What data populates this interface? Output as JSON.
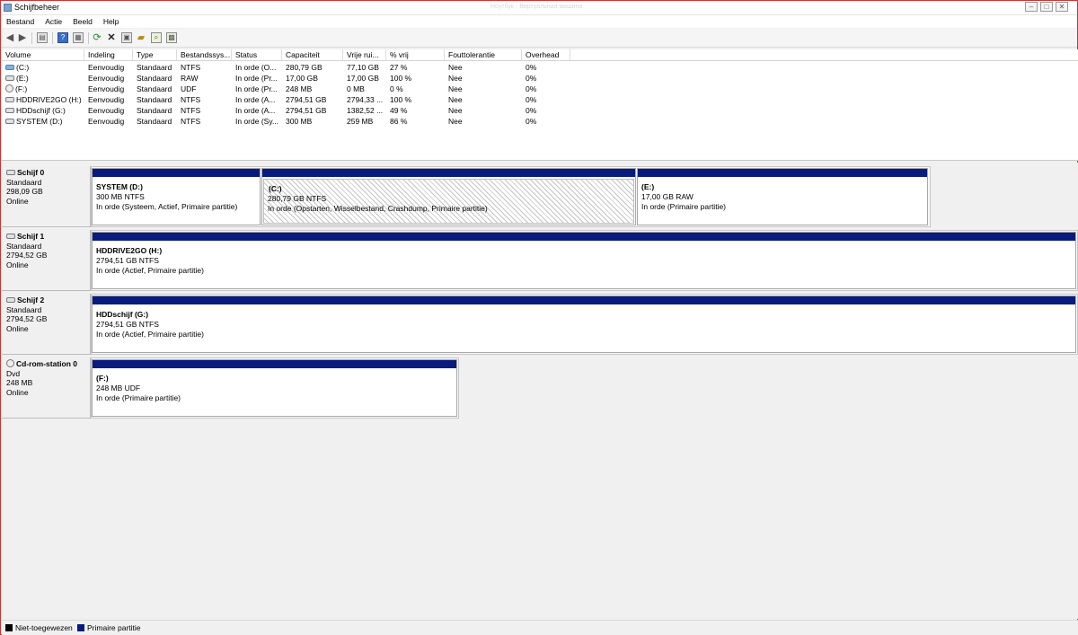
{
  "window": {
    "title": "Schijfbeheer",
    "faint_title": "Ноутбук - Виртуальная машина",
    "controls": {
      "minimize": "–",
      "maximize": "□",
      "close": "✕"
    }
  },
  "menu": [
    "Bestand",
    "Actie",
    "Beeld",
    "Help"
  ],
  "toolbar": [
    "back-icon",
    "forward-icon",
    "console-tree-icon",
    "help-icon",
    "properties-icon",
    "refresh-icon",
    "delete-icon",
    "new-volume-icon",
    "open-icon",
    "search-icon",
    "help-topics-icon"
  ],
  "volume_table": {
    "columns": [
      "Volume",
      "Indeling",
      "Type",
      "Bestandssys...",
      "Status",
      "Capaciteit",
      "Vrije rui...",
      "% vrij",
      "Fouttolerantie",
      "Overhead"
    ],
    "rows": [
      {
        "name": "(C:)",
        "icon": "system-disk-icon",
        "layout": "Eenvoudig",
        "type": "Standaard",
        "fs": "NTFS",
        "status": "In orde (O...",
        "capacity": "280,79 GB",
        "free": "77,10 GB",
        "pct_free": "27 %",
        "fault": "Nee",
        "overhead": "0%"
      },
      {
        "name": "(E:)",
        "icon": "disk-icon",
        "layout": "Eenvoudig",
        "type": "Standaard",
        "fs": "RAW",
        "status": "In orde (Pr...",
        "capacity": "17,00 GB",
        "free": "17,00 GB",
        "pct_free": "100 %",
        "fault": "Nee",
        "overhead": "0%"
      },
      {
        "name": "(F:)",
        "icon": "cd-icon",
        "layout": "Eenvoudig",
        "type": "Standaard",
        "fs": "UDF",
        "status": "In orde (Pr...",
        "capacity": "248 MB",
        "free": "0 MB",
        "pct_free": "0 %",
        "fault": "Nee",
        "overhead": "0%"
      },
      {
        "name": "HDDRIVE2GO (H:)",
        "icon": "disk-icon",
        "layout": "Eenvoudig",
        "type": "Standaard",
        "fs": "NTFS",
        "status": "In orde (A...",
        "capacity": "2794,51 GB",
        "free": "2794,33 ...",
        "pct_free": "100 %",
        "fault": "Nee",
        "overhead": "0%"
      },
      {
        "name": "HDDschijf (G:)",
        "icon": "disk-icon",
        "layout": "Eenvoudig",
        "type": "Standaard",
        "fs": "NTFS",
        "status": "In orde (A...",
        "capacity": "2794,51 GB",
        "free": "1382,52 ...",
        "pct_free": "49 %",
        "fault": "Nee",
        "overhead": "0%"
      },
      {
        "name": "SYSTEM (D:)",
        "icon": "disk-icon",
        "layout": "Eenvoudig",
        "type": "Standaard",
        "fs": "NTFS",
        "status": "In orde (Sy...",
        "capacity": "300 MB",
        "free": "259 MB",
        "pct_free": "86 %",
        "fault": "Nee",
        "overhead": "0%"
      }
    ]
  },
  "disks": [
    {
      "name": "Schijf 0",
      "type": "Standaard",
      "size": "298,09 GB",
      "state": "Online",
      "partitions": [
        {
          "name": "SYSTEM  (D:)",
          "size": "300 MB NTFS",
          "status": "In orde (Systeem, Actief, Primaire partitie)",
          "selected": false
        },
        {
          "name": "(C:)",
          "size": "280,79 GB NTFS",
          "status": "In orde (Opstarten, Wisselbestand, Crashdump, Primaire partitie)",
          "selected": true
        },
        {
          "name": "(E:)",
          "size": "17,00 GB RAW",
          "status": "In orde (Primaire partitie)",
          "selected": false
        }
      ]
    },
    {
      "name": "Schijf 1",
      "type": "Standaard",
      "size": "2794,52 GB",
      "state": "Online",
      "partitions": [
        {
          "name": "HDDRIVE2GO  (H:)",
          "size": "2794,51 GB NTFS",
          "status": "In orde (Actief, Primaire partitie)",
          "selected": false
        }
      ]
    },
    {
      "name": "Schijf 2",
      "type": "Standaard",
      "size": "2794,52 GB",
      "state": "Online",
      "partitions": [
        {
          "name": "HDDschijf  (G:)",
          "size": "2794,51 GB NTFS",
          "status": "In orde (Actief, Primaire partitie)",
          "selected": false
        }
      ]
    },
    {
      "name": "Cd-rom-station 0",
      "type": "Dvd",
      "size": "248 MB",
      "state": "Online",
      "partitions": [
        {
          "name": "(F:)",
          "size": "248 MB UDF",
          "status": "In orde (Primaire partitie)",
          "selected": false
        }
      ]
    }
  ],
  "legend": [
    {
      "label": "Niet-toegewezen",
      "color": "#000000"
    },
    {
      "label": "Primaire partitie",
      "color": "#0a1b7e"
    }
  ],
  "colors": {
    "partition_bar": "#0a1b7e",
    "window_border": "#cc3333"
  }
}
